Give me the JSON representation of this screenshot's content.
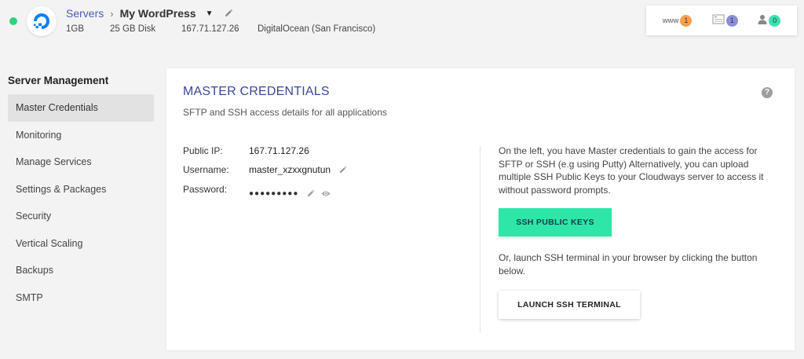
{
  "header": {
    "breadcrumb_root": "Servers",
    "breadcrumb_sep": "›",
    "server_name": "My WordPress",
    "meta": {
      "ram": "1GB",
      "disk": "25 GB Disk",
      "ip": "167.71.127.26",
      "provider": "DigitalOcean (San Francisco)"
    },
    "stats": {
      "www_label": "www",
      "www_count": "1",
      "files_count": "1",
      "users_count": "0"
    }
  },
  "sidebar": {
    "heading": "Server Management",
    "items": [
      {
        "label": "Master Credentials"
      },
      {
        "label": "Monitoring"
      },
      {
        "label": "Manage Services"
      },
      {
        "label": "Settings & Packages"
      },
      {
        "label": "Security"
      },
      {
        "label": "Vertical Scaling"
      },
      {
        "label": "Backups"
      },
      {
        "label": "SMTP"
      }
    ]
  },
  "main": {
    "title": "MASTER CREDENTIALS",
    "subtitle": "SFTP and SSH access details for all applications",
    "help": "?",
    "credentials": {
      "public_ip_label": "Public IP:",
      "public_ip_value": "167.71.127.26",
      "username_label": "Username:",
      "username_value": "master_xzxxgnutun",
      "password_label": "Password:",
      "password_mask": "●●●●●●●●●"
    },
    "info_text": "On the left, you have Master credentials to gain the access for SFTP or SSH (e.g using Putty) Alternatively, you can upload multiple SSH Public Keys to your Cloudways server to access it without password prompts.",
    "ssh_keys_button": "SSH PUBLIC KEYS",
    "info_text2": "Or, launch SSH terminal in your browser by clicking the button below.",
    "terminal_button": "LAUNCH SSH TERMINAL"
  },
  "colors": {
    "accent": "#2ee6a8",
    "title": "#3b4699",
    "status": "#2ed47a",
    "badge_orange": "#f5a04a",
    "badge_purple": "#8b8fd9",
    "badge_green": "#3de0b0"
  },
  "icons": [
    "digitalocean-logo",
    "pencil-icon",
    "caret-down-icon",
    "file-icon",
    "user-icon",
    "eye-icon",
    "help-icon"
  ]
}
